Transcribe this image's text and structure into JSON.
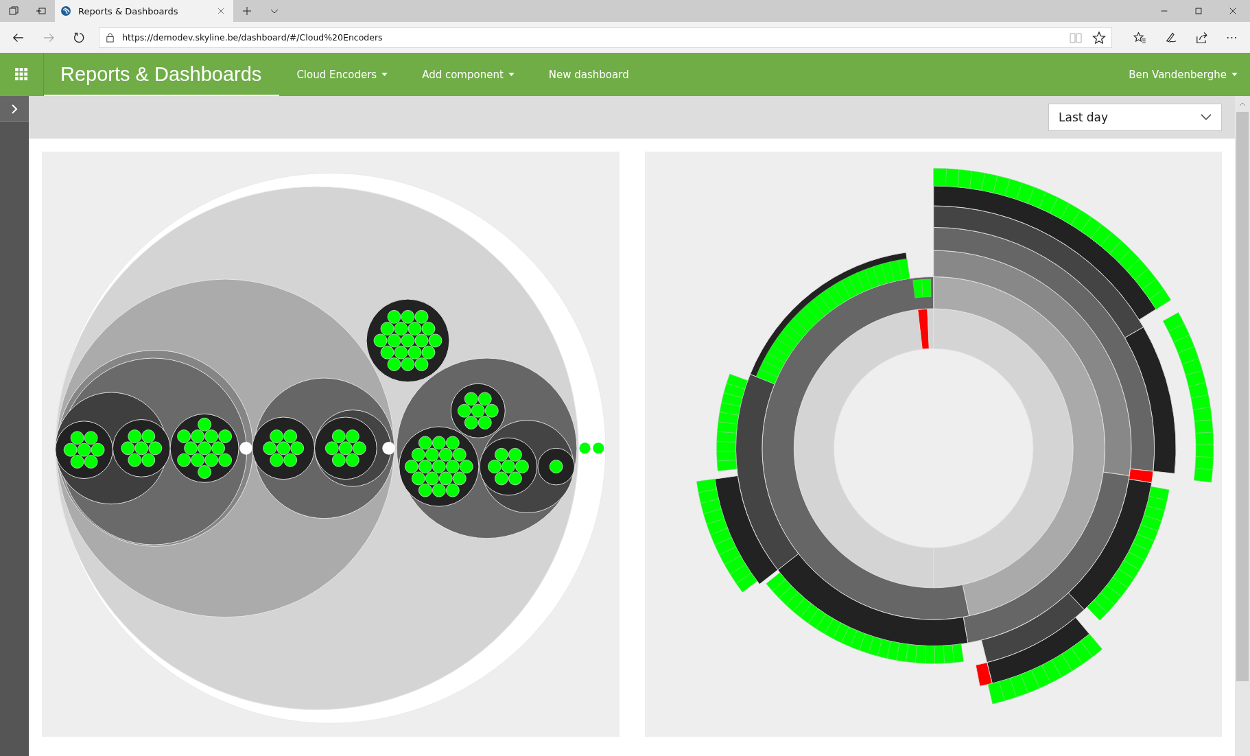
{
  "browser": {
    "tab": {
      "title": "Reports & Dashboards"
    },
    "address": "https://demodev.skyline.be/dashboard/#/Cloud%20Encoders"
  },
  "header": {
    "title": "Reports & Dashboards",
    "menu": [
      {
        "label": "Cloud Encoders",
        "dropdown": true
      },
      {
        "label": "Add component",
        "dropdown": true
      },
      {
        "label": "New dashboard",
        "dropdown": false
      }
    ],
    "user": "Ben Vandenberghe"
  },
  "time_range": {
    "value": "Last day"
  }
}
